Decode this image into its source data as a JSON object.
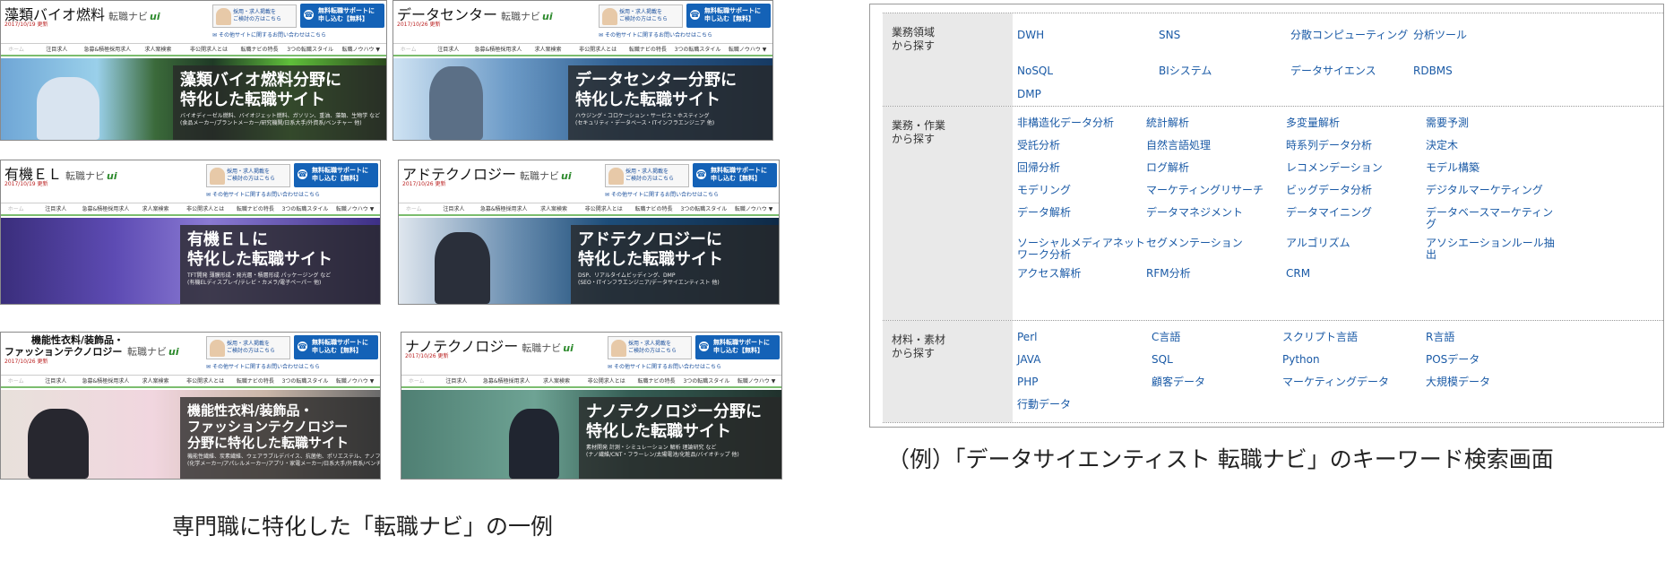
{
  "cards": [
    {
      "name": "藻類バイオ燃料",
      "sub": "転職ナビ",
      "mark": "ui",
      "date": "2017/10/19 更新",
      "hero_title": [
        "藻類バイオ燃料分野に",
        "特化した転職サイト"
      ],
      "hero_sub": [
        "バイオディーゼル燃料、バイオジェット燃料、ガソリン、重油、藻類、生物学 など",
        "(食品メーカー/プラントメーカー/研究機関/日系大手/外資系/ベンチャー 他)"
      ]
    },
    {
      "name": "データセンター",
      "sub": "転職ナビ",
      "mark": "ui",
      "date": "2017/10/26 更新",
      "hero_title": [
        "データセンター分野に",
        "特化した転職サイト"
      ],
      "hero_sub": [
        "ハウジング・コロケーション・サービス・ホスティング",
        "(セキュリティ・データベース・ITインフラエンジニア 他)"
      ]
    },
    {
      "name": "有機ＥＬ",
      "sub": "転職ナビ",
      "mark": "ui",
      "date": "2017/10/19 更新",
      "hero_title": [
        "有機ＥＬに",
        "特化した転職サイト"
      ],
      "hero_sub": [
        "TFT開発 薄膜形成・発光層・積層形成 パッケージング など",
        "(有機ELディスプレイ/テレビ・カメラ/電子ペーパー 他)"
      ]
    },
    {
      "name": "アドテクノロジー",
      "sub": "転職ナビ",
      "mark": "ui",
      "date": "2017/10/26 更新",
      "hero_title": [
        "アドテクノロジーに",
        "特化した転職サイト"
      ],
      "hero_sub": [
        "DSP、リアルタイムビッディング、DMP",
        "(SEO・ITインフラエンジニア/データサイエンティスト 他)"
      ]
    },
    {
      "name": "機能性衣料/装飾品・",
      "name2": "ファッションテクノロジー",
      "sub": "転職ナビ",
      "mark": "ui",
      "date": "2017/10/26 更新",
      "hero_title": [
        "機能性衣料/装飾品・",
        "ファッションテクノロジー",
        "分野に特化した転職サイト"
      ],
      "hero_sub": [
        "機能性繊維、炭素繊維、ウェアラブルデバイス、抗菌他、ポリエステル、ナノファイバー など",
        "(化学メーカー/アパレルメーカー/アプリ・家電メーカー/日系大手/外資系/ベンチャー 他)"
      ]
    },
    {
      "name": "ナノテクノロジー",
      "sub": "転職ナビ",
      "mark": "ui",
      "date": "2017/10/26 更新",
      "hero_title": [
        "ナノテクノロジー分野に",
        "特化した転職サイト"
      ],
      "hero_sub": [
        "素材開発 計測・シミュレーション 解析 理論研究 など",
        "(ナノ繊維/CNT・フラーレン/太陽電池/化粧品/バイオチップ 他)"
      ]
    }
  ],
  "card_common": {
    "recruit_text": [
      "採用・求人掲載を",
      "ご検討の方はこちら"
    ],
    "cta_text": [
      "無料転職サポートに",
      "申し込む【無料】"
    ],
    "contact": "その他サイトに関するお問い合わせはこちら",
    "nav": [
      "ホーム",
      "注目求人",
      "急募&積極採用求人",
      "求人案検索",
      "非公開求人とは",
      "転職ナビの特長",
      "3つの転職スタイル",
      "転職ノウハウ ▼"
    ]
  },
  "keyword_sections": [
    {
      "label": [
        "業務領域",
        "から探す"
      ],
      "items": [
        [
          "DWH",
          "SNS",
          "分散コンピューティング",
          "分析ツール"
        ],
        [
          "NoSQL",
          "BIシステム",
          "データサイエンス",
          "RDBMS"
        ],
        [
          "DMP"
        ]
      ]
    },
    {
      "label": [
        "業務・作業",
        "から探す"
      ],
      "items": [
        [
          "非構造化データ分析",
          "統計解析",
          "多変量解析",
          "需要予測"
        ],
        [
          "受託分析",
          "自然言語処理",
          "時系列データ分析",
          "決定木"
        ],
        [
          "回帰分析",
          "ログ解析",
          "レコメンデーション",
          "モデル構築"
        ],
        [
          "モデリング",
          "マーケティングリサーチ",
          "ビッグデータ分析",
          "デジタルマーケティング"
        ],
        [
          "データ解析",
          "データマネジメント",
          "データマイニング",
          "データベースマーケティング"
        ],
        [
          "ソーシャルメディアネットワーク分析",
          "セグメンテーション",
          "アルゴリズム",
          "アソシエーションルール抽出"
        ],
        [
          "アクセス解析",
          "RFM分析",
          "CRM"
        ]
      ]
    },
    {
      "label": [
        "材料・素材",
        "から探す"
      ],
      "items": [
        [
          "Perl",
          "C言語",
          "スクリプト言語",
          "R言語"
        ],
        [
          "JAVA",
          "SQL",
          "Python",
          "POSデータ"
        ],
        [
          "PHP",
          "顧客データ",
          "マーケティングデータ",
          "大規模データ"
        ],
        [
          "行動データ"
        ]
      ]
    }
  ],
  "captions": {
    "left": "専門職に特化した「転職ナビ」の一例",
    "right": "（例）「データサイエンティスト 転職ナビ」のキーワード検索画面"
  }
}
